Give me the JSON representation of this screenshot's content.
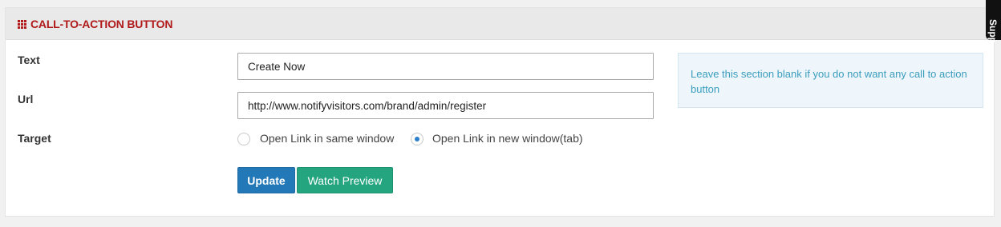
{
  "section": {
    "title": "CALL-TO-ACTION BUTTON",
    "icon": "grid-icon",
    "accent_color": "#b01a1a"
  },
  "form": {
    "text_label": "Text",
    "text_value": "Create Now",
    "url_label": "Url",
    "url_value": "http://www.notifyvisitors.com/brand/admin/register",
    "target_label": "Target",
    "target_options": [
      {
        "label": "Open Link in same window",
        "selected": false
      },
      {
        "label": "Open Link in new window(tab)",
        "selected": true
      }
    ]
  },
  "buttons": {
    "update_label": "Update",
    "preview_label": "Watch Preview",
    "update_color": "#2379b8",
    "preview_color": "#25a57f"
  },
  "note": {
    "text": "Leave this section blank if you do not want any call to action button"
  },
  "support_tab": {
    "label": "Supp"
  }
}
